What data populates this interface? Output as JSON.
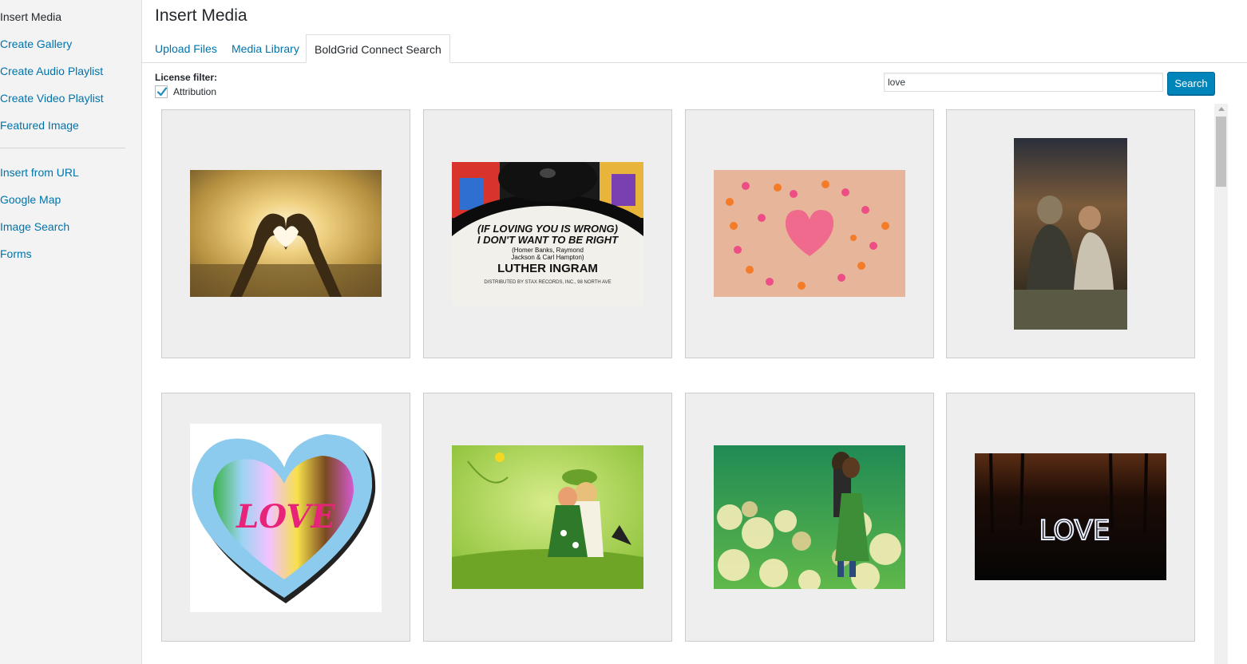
{
  "sidebar": {
    "items": [
      {
        "label": "Insert Media"
      },
      {
        "label": "Create Gallery"
      },
      {
        "label": "Create Audio Playlist"
      },
      {
        "label": "Create Video Playlist"
      },
      {
        "label": "Featured Image"
      },
      {
        "label": "Insert from URL"
      },
      {
        "label": "Google Map"
      },
      {
        "label": "Image Search"
      },
      {
        "label": "Forms"
      }
    ]
  },
  "header": {
    "title": "Insert Media",
    "tabs": [
      {
        "label": "Upload Files"
      },
      {
        "label": "Media Library"
      },
      {
        "label": "BoldGrid Connect Search"
      }
    ]
  },
  "filter": {
    "label": "License filter:",
    "attribution_label": "Attribution",
    "attribution_checked": true
  },
  "search": {
    "value": "love",
    "button_label": "Search"
  },
  "results": [
    {
      "subject": "heart-hands-sunset"
    },
    {
      "subject": "vinyl-record-luther-ingram",
      "text_lines": [
        "(IF LOVING YOU IS WRONG)",
        "I DON'T WANT TO BE RIGHT",
        "(Homer Banks, Raymond",
        "Jackson & Carl Hampton)",
        "LUTHER INGRAM",
        "DISTRIBUTED BY STAX RECORDS, INC., 98 NORTH AVE"
      ]
    },
    {
      "subject": "paper-heart-ants"
    },
    {
      "subject": "mother-and-child"
    },
    {
      "subject": "rainbow-heart",
      "text_lines": [
        "LOVE"
      ]
    },
    {
      "subject": "green-couple-illustration"
    },
    {
      "subject": "couple-in-flower-field"
    },
    {
      "subject": "light-painting-love",
      "text_lines": [
        "LOVE"
      ]
    }
  ],
  "colors": {
    "link": "#0073aa",
    "primary_button": "#0085ba",
    "sidebar_bg": "#f3f3f3"
  },
  "icons": {
    "license": "globe-icon",
    "checkbox": "checkmark-icon"
  }
}
